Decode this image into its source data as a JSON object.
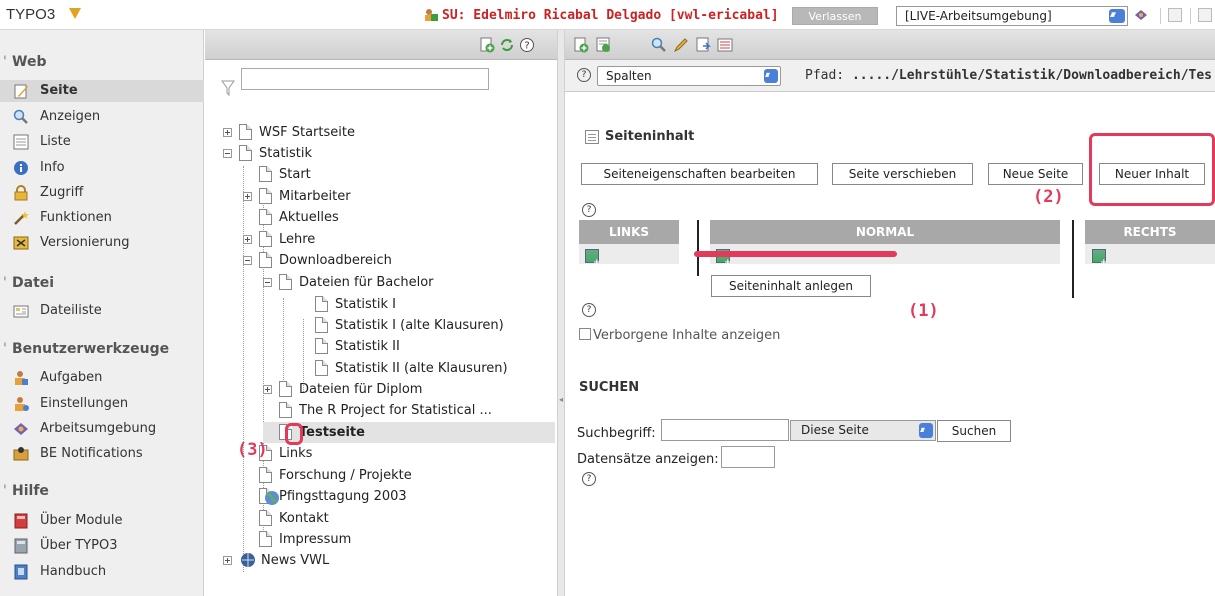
{
  "topbar": {
    "logo": "TYPO3",
    "su_label": "SU:  Edelmiro Ricabal Delgado [vwl-ericabal]",
    "leave_button": "Verlassen",
    "workspace": "[LIVE-Arbeitsumgebung]"
  },
  "modules": {
    "web": {
      "title": "Web",
      "items": [
        {
          "label": "Seite",
          "icon": "page-edit-icon"
        },
        {
          "label": "Anzeigen",
          "icon": "magnifier-icon"
        },
        {
          "label": "Liste",
          "icon": "list-icon"
        },
        {
          "label": "Info",
          "icon": "info-icon"
        },
        {
          "label": "Zugriff",
          "icon": "lock-icon"
        },
        {
          "label": "Funktionen",
          "icon": "wand-icon"
        },
        {
          "label": "Versionierung",
          "icon": "version-icon"
        }
      ]
    },
    "datei": {
      "title": "Datei",
      "items": [
        {
          "label": "Dateiliste",
          "icon": "folder-list-icon"
        }
      ]
    },
    "user": {
      "title": "Benutzerwerkzeuge",
      "items": [
        {
          "label": "Aufgaben",
          "icon": "user-tasks-icon"
        },
        {
          "label": "Einstellungen",
          "icon": "user-settings-icon"
        },
        {
          "label": "Arbeitsumgebung",
          "icon": "workspace-icon"
        },
        {
          "label": "BE Notifications",
          "icon": "notification-icon"
        }
      ]
    },
    "hilfe": {
      "title": "Hilfe",
      "items": [
        {
          "label": "Über Module",
          "icon": "book-red-icon"
        },
        {
          "label": "Über TYPO3",
          "icon": "about-icon"
        },
        {
          "label": "Handbuch",
          "icon": "manual-icon"
        }
      ]
    }
  },
  "tree": {
    "filter_value": "",
    "nodes": [
      "WSF Startseite",
      "Statistik",
      "Start",
      "Mitarbeiter",
      "Aktuelles",
      "Lehre",
      "Downloadbereich",
      "Dateien für Bachelor",
      "Statistik I",
      "Statistik I (alte Klausuren)",
      "Statistik II",
      "Statistik II (alte Klausuren)",
      "Dateien für Diplom",
      "The R Project for Statistical ...",
      "Testseite",
      "Links",
      "Forschung / Projekte",
      "Pfingsttagung 2003",
      "Kontakt",
      "Impressum",
      "News VWL"
    ]
  },
  "content": {
    "view_select": "Spalten",
    "path_label": "Pfad:",
    "path_value": "...../Lehrstühle/Statistik/Downloadbereich/Tes",
    "section_title": "Seiteninhalt",
    "buttons": {
      "edit_props": "Seiteneigenschaften bearbeiten",
      "move_page": "Seite verschieben",
      "new_page": "Neue Seite",
      "new_content": "Neuer Inhalt",
      "create_content": "Seiteninhalt anlegen"
    },
    "columns": {
      "left": "LINKS",
      "normal": "NORMAL",
      "right": "RECHTS"
    },
    "hidden_label": "Verborgene Inhalte anzeigen",
    "search": {
      "title": "SUCHEN",
      "term_label": "Suchbegriff:",
      "term_value": "",
      "scope": "Diese Seite",
      "button": "Suchen",
      "records_label": "Datensätze anzeigen:",
      "records_value": ""
    }
  },
  "annotations": {
    "a1": "(1)",
    "a2": "(2)",
    "a3": "(3)",
    "color": "#e23a5a"
  },
  "colors": {
    "annotation": "#e23a5a",
    "su_text": "#cc2222",
    "select_arrow": "#4a80d9"
  }
}
